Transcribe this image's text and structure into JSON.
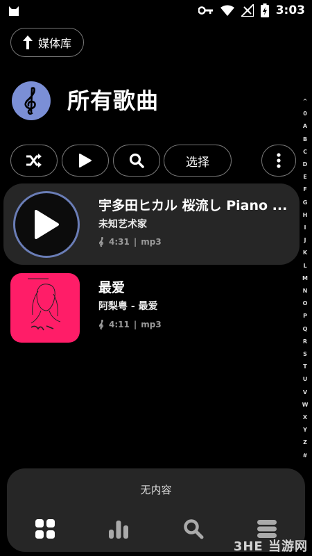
{
  "status_bar": {
    "time": "3:03"
  },
  "library_button": {
    "label": "媒体库"
  },
  "header": {
    "title": "所有歌曲"
  },
  "controls": {
    "select_label": "选择"
  },
  "alphabet": [
    "^",
    "0",
    "A",
    "B",
    "C",
    "D",
    "E",
    "F",
    "G",
    "H",
    "I",
    "J",
    "K",
    "L",
    "M",
    "N",
    "O",
    "P",
    "Q",
    "R",
    "S",
    "T",
    "U",
    "V",
    "W",
    "X",
    "Y",
    "Z",
    "#"
  ],
  "songs": [
    {
      "title": "宇多田ヒカル 桜流し  Piano ...",
      "artist": "未知艺术家",
      "duration": "4:31",
      "format": "mp3",
      "playing": true
    },
    {
      "title": "最爱",
      "artist": "阿梨粤 - 最爱",
      "duration": "4:11",
      "format": "mp3",
      "playing": false
    }
  ],
  "now_playing": {
    "empty_text": "无内容"
  },
  "watermark": "3HE 当游网",
  "colors": {
    "accent": "#7b8fd6",
    "cover": "#ff1d68",
    "panel": "#262626"
  }
}
